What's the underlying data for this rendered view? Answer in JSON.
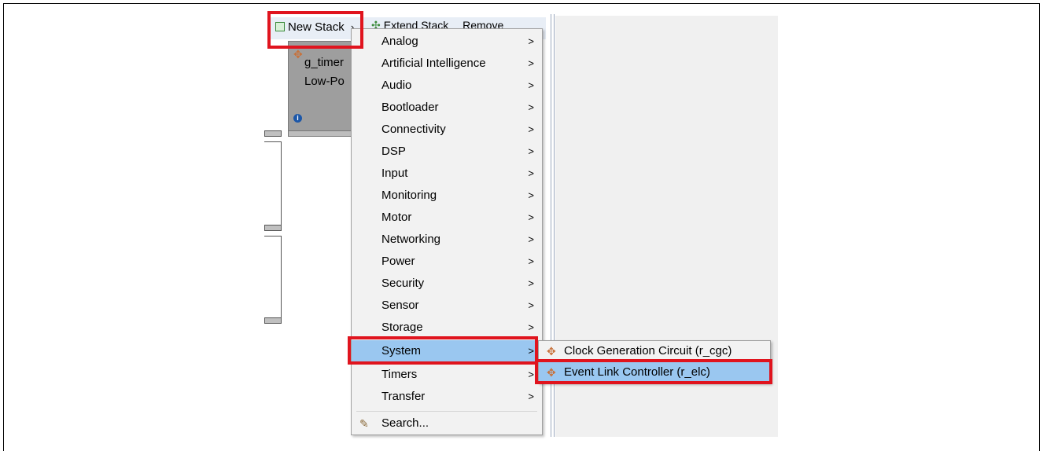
{
  "toolbar": {
    "new_stack_label": "New Stack",
    "new_stack_arrow": "›",
    "extend_stack_label": "Extend Stack",
    "remove_label": "Remove"
  },
  "stack": {
    "name": "g_timer",
    "description": "Low-Po",
    "info_glyph": "i"
  },
  "menu": {
    "items": [
      {
        "label": "Analog"
      },
      {
        "label": "Artificial Intelligence"
      },
      {
        "label": "Audio"
      },
      {
        "label": "Bootloader"
      },
      {
        "label": "Connectivity"
      },
      {
        "label": "DSP"
      },
      {
        "label": "Input"
      },
      {
        "label": "Monitoring"
      },
      {
        "label": "Motor"
      },
      {
        "label": "Networking"
      },
      {
        "label": "Power"
      },
      {
        "label": "Security"
      },
      {
        "label": "Sensor"
      },
      {
        "label": "Storage"
      },
      {
        "label": "System"
      },
      {
        "label": "Timers"
      },
      {
        "label": "Transfer"
      }
    ],
    "arrow_glyph": ">",
    "search_label": "Search...",
    "selected": "System"
  },
  "submenu": {
    "items": [
      {
        "label": "Clock Generation Circuit (r_cgc)"
      },
      {
        "label": "Event Link Controller (r_elc)"
      }
    ],
    "selected": "Event Link Controller (r_elc)"
  },
  "colors": {
    "highlight_box": "#e0141e",
    "selection": "#9ac7f0",
    "menu_bg": "#f2f2f2"
  },
  "icons": {
    "new_stack": "add-stack-icon",
    "extend_stack": "extend-stack-icon",
    "module": "module-icon",
    "search": "search-wand-icon",
    "info": "info-icon",
    "submenu_arrow": "chevron-right-icon"
  }
}
